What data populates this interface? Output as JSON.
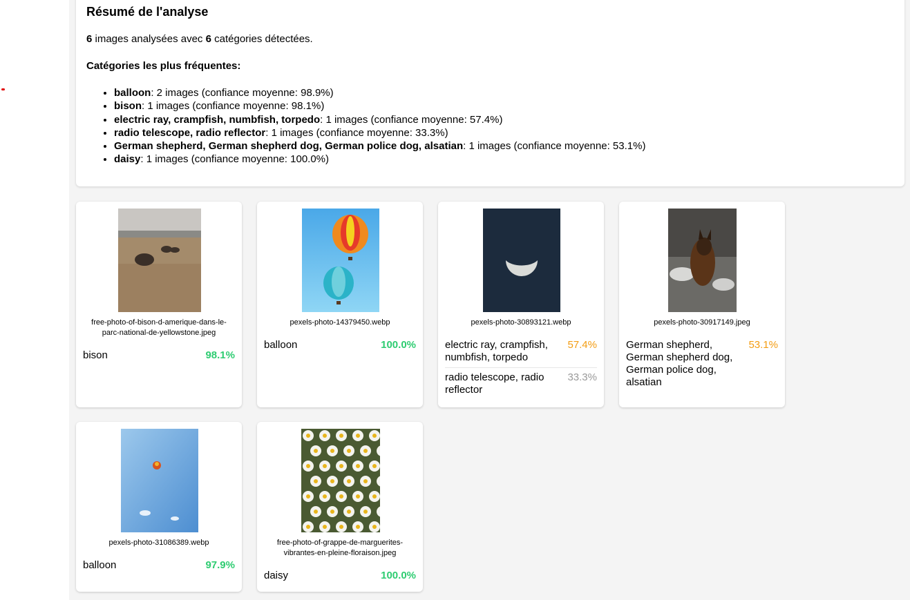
{
  "summary": {
    "title": "Résumé de l'analyse",
    "images_count": "6",
    "categories_count": "6",
    "count_text_mid": " images analysées avec ",
    "count_text_end": " catégories détectées.",
    "frequent_title": "Catégories les plus fréquentes:",
    "categories": [
      {
        "name": "balloon",
        "detail": ": 2 images (confiance moyenne: 98.9%)"
      },
      {
        "name": "bison",
        "detail": ": 1 images (confiance moyenne: 98.1%)"
      },
      {
        "name": "electric ray, crampfish, numbfish, torpedo",
        "detail": ": 1 images (confiance moyenne: 57.4%)"
      },
      {
        "name": "radio telescope, radio reflector",
        "detail": ": 1 images (confiance moyenne: 33.3%)"
      },
      {
        "name": "German shepherd, German shepherd dog, German police dog, alsatian",
        "detail": ": 1 images (confiance moyenne: 53.1%)"
      },
      {
        "name": "daisy",
        "detail": ": 1 images (confiance moyenne: 100.0%)"
      }
    ]
  },
  "cards": [
    {
      "filename": "free-photo-of-bison-d-amerique-dans-le-parc-national-de-yellowstone.jpeg",
      "image": "bison-photo",
      "predictions": [
        {
          "label": "bison",
          "confidence": "98.1%"
        }
      ]
    },
    {
      "filename": "pexels-photo-14379450.webp",
      "image": "hot-air-balloons-photo",
      "predictions": [
        {
          "label": "balloon",
          "confidence": "100.0%"
        }
      ]
    },
    {
      "filename": "pexels-photo-30893121.webp",
      "image": "moon-photo",
      "predictions": [
        {
          "label": "electric ray, crampfish, numbfish, torpedo",
          "confidence": "57.4%"
        },
        {
          "label": "radio telescope, radio reflector",
          "confidence": "33.3%"
        }
      ]
    },
    {
      "filename": "pexels-photo-30917149.jpeg",
      "image": "dog-photo",
      "predictions": [
        {
          "label": "German shepherd, German shepherd dog, German police dog, alsatian",
          "confidence": "53.1%"
        }
      ]
    },
    {
      "filename": "pexels-photo-31086389.webp",
      "image": "sky-balloon-photo",
      "predictions": [
        {
          "label": "balloon",
          "confidence": "97.9%"
        }
      ]
    },
    {
      "filename": "free-photo-of-grappe-de-marguerites-vibrantes-en-pleine-floraison.jpeg",
      "image": "daisies-photo",
      "predictions": [
        {
          "label": "daisy",
          "confidence": "100.0%"
        }
      ]
    }
  ],
  "colors": {
    "high": "#2ecc71",
    "medium": "#f39c12",
    "low": "#999999"
  }
}
